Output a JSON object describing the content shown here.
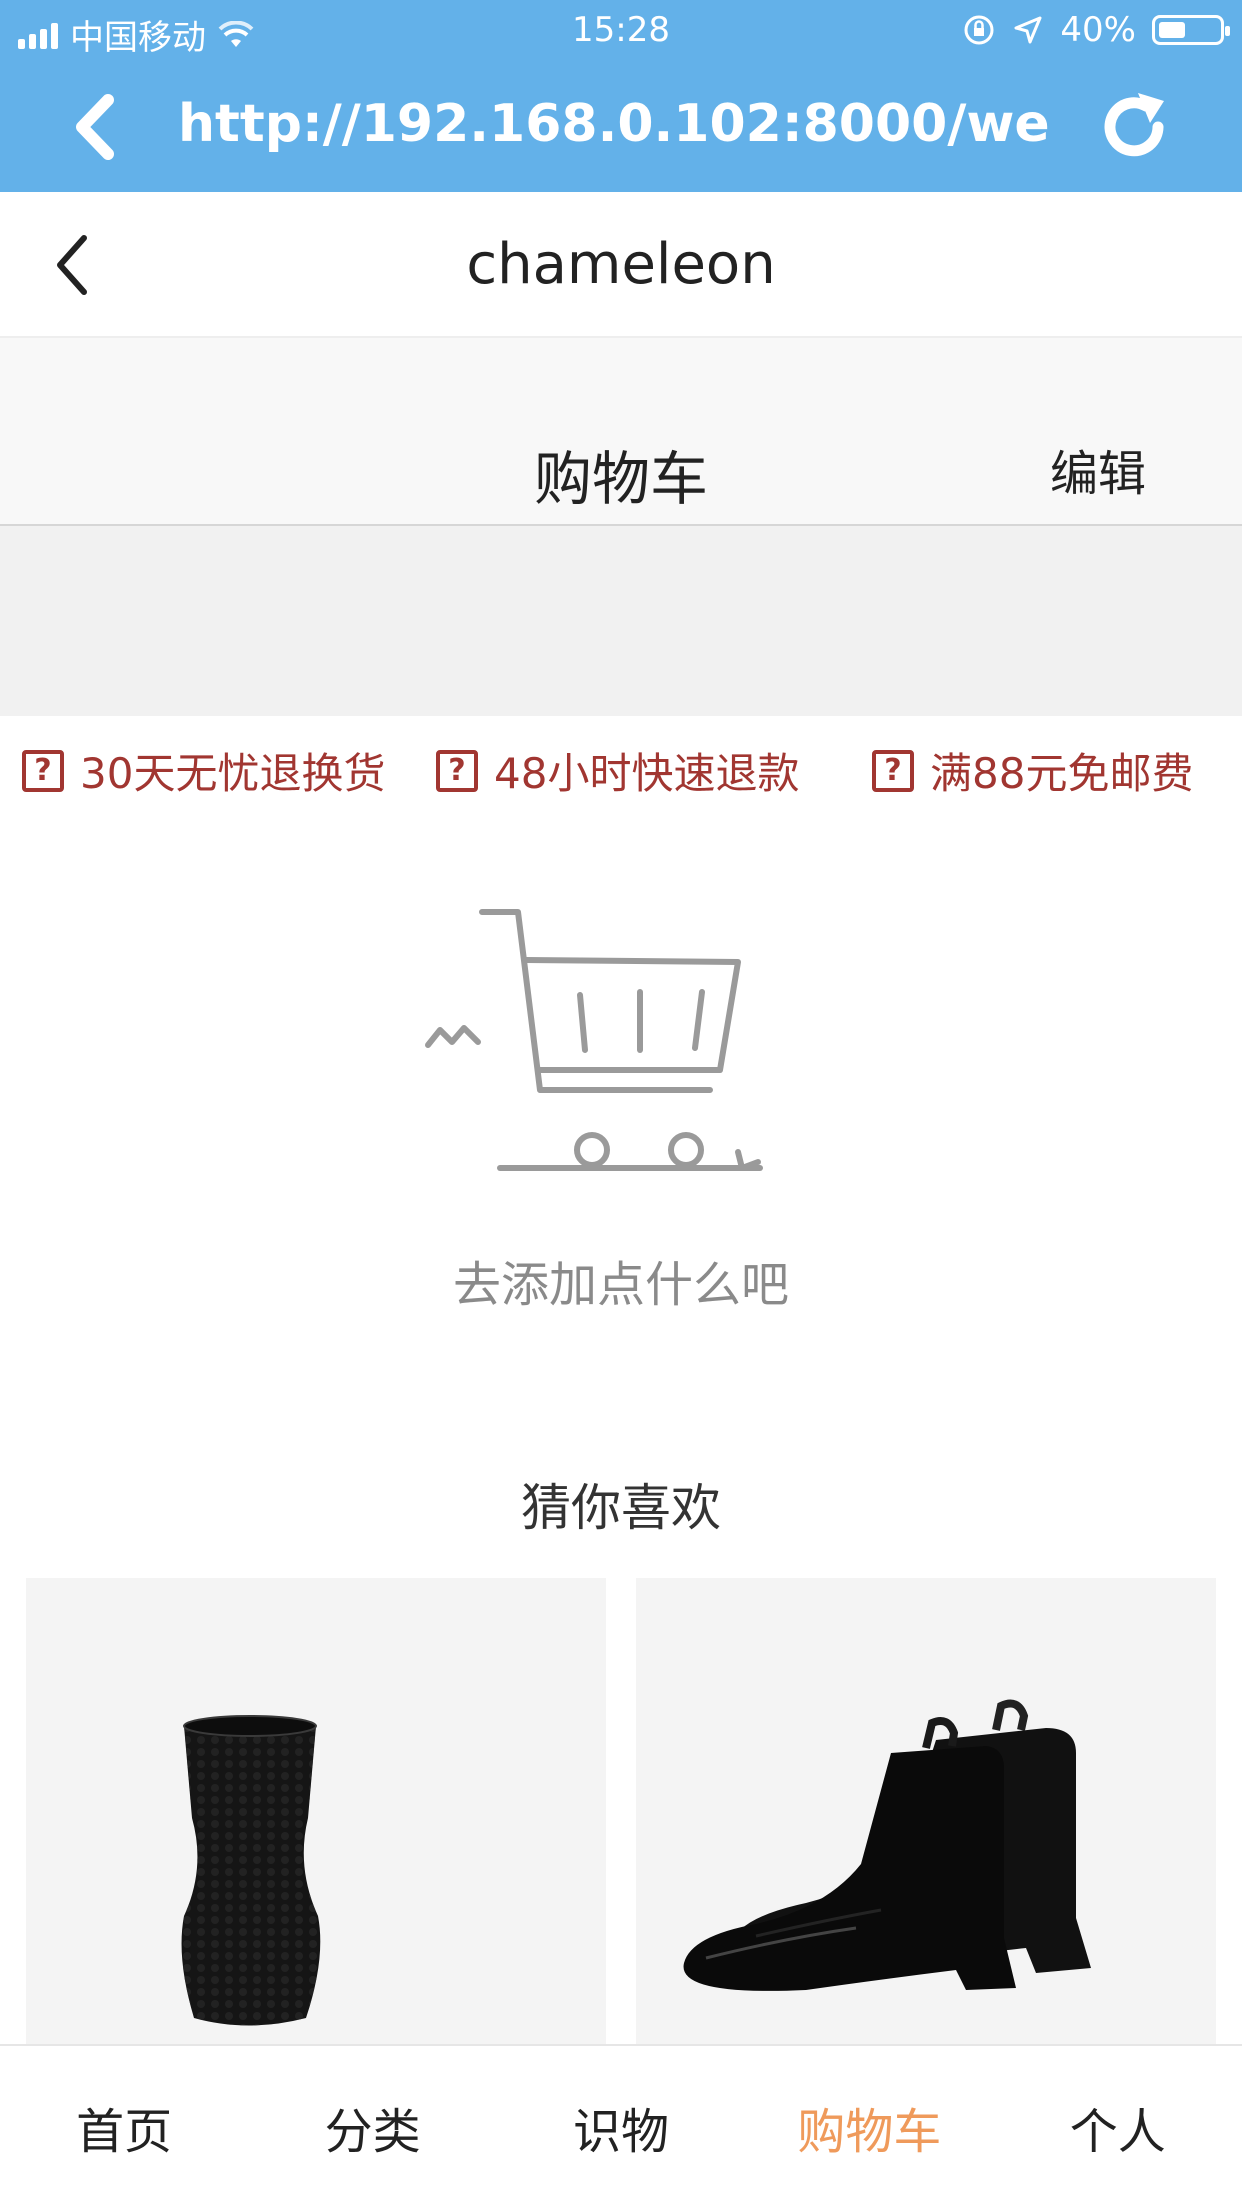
{
  "status_bar": {
    "carrier": "中国移动",
    "time": "15:28",
    "battery": "40%"
  },
  "browser": {
    "url": "http://192.168.0.102:8000/weex/c..."
  },
  "nav": {
    "title": "chameleon"
  },
  "cart_header": {
    "title": "购物车",
    "edit_label": "编辑"
  },
  "guarantees": [
    {
      "label": "30天无忧退换货"
    },
    {
      "label": "48小时快速退款"
    },
    {
      "label": "满88元免邮费"
    }
  ],
  "empty_cart": {
    "message": "去添加点什么吧"
  },
  "recommend": {
    "title": "猜你喜欢",
    "products": [
      {
        "image_icon": "black-cup-image"
      },
      {
        "image_icon": "black-boots-image"
      }
    ]
  },
  "tabs": [
    {
      "label": "首页",
      "active": false
    },
    {
      "label": "分类",
      "active": false
    },
    {
      "label": "识物",
      "active": false
    },
    {
      "label": "购物车",
      "active": true
    },
    {
      "label": "个人",
      "active": false
    }
  ],
  "colors": {
    "browser_bar": "#63b1e9",
    "guarantee_red": "#a13631",
    "active_tab": "#ef9a5b"
  }
}
